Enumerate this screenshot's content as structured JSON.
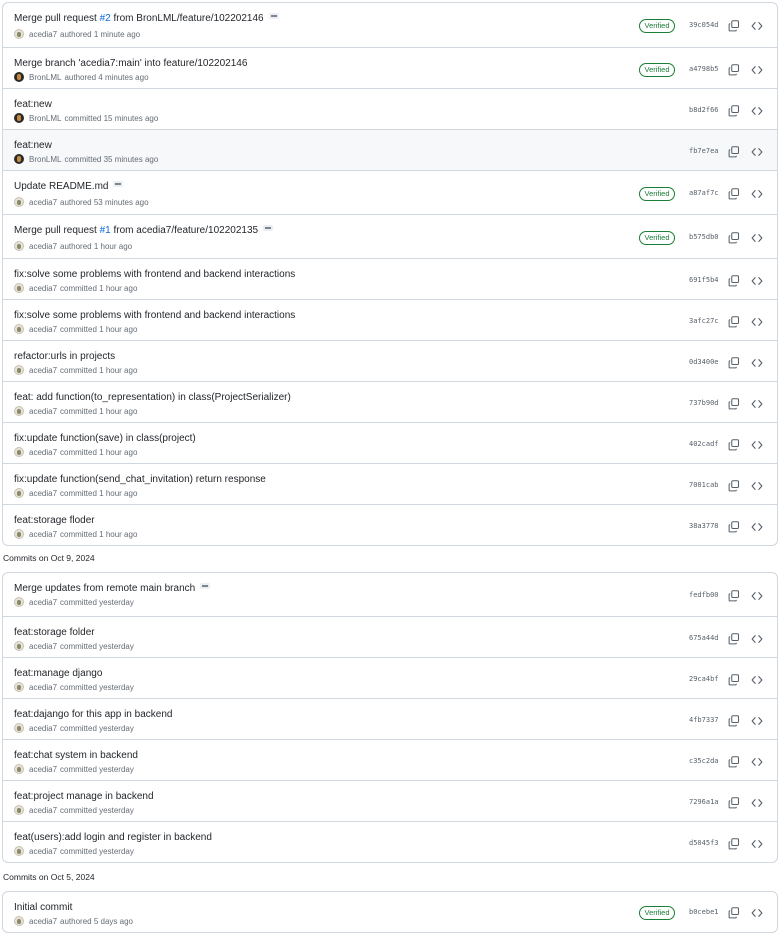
{
  "groups": [
    {
      "heading": null,
      "commits": [
        {
          "title": "Merge pull request ",
          "link": "#2",
          "title_after": " from BronLML/feature/102202146",
          "has_ellipsis": true,
          "author": "acedia7",
          "action": "authored 1 minute ago",
          "avatar": "acedia",
          "verified": true,
          "sha": "39c054d",
          "height": 44,
          "hl": false
        },
        {
          "title": "Merge branch 'acedia7:main' into feature/102202146",
          "author": "BronLML",
          "action": "authored 4 minutes ago",
          "avatar": "bron",
          "verified": true,
          "sha": "a4798b5",
          "height": 41,
          "hl": false
        },
        {
          "title": "feat:new",
          "author": "BronLML",
          "action": "committed 15 minutes ago",
          "avatar": "bron",
          "verified": false,
          "sha": "b8d2f66",
          "height": 41,
          "hl": false
        },
        {
          "title": "feat:new",
          "author": "BronLML",
          "action": "committed 35 minutes ago",
          "avatar": "bron",
          "verified": false,
          "sha": "fb7e7ea",
          "height": 41,
          "hl": true
        },
        {
          "title": "Update README.md",
          "has_ellipsis": true,
          "author": "acedia7",
          "action": "authored 53 minutes ago",
          "avatar": "acedia",
          "verified": true,
          "sha": "a87af7c",
          "height": 44,
          "hl": false
        },
        {
          "title": "Merge pull request ",
          "link": "#1",
          "title_after": " from acedia7/feature/102202135",
          "has_ellipsis": true,
          "author": "acedia7",
          "action": "authored 1 hour ago",
          "avatar": "acedia",
          "verified": true,
          "sha": "b575db0",
          "height": 44,
          "hl": false
        },
        {
          "title": "fix:solve some problems with frontend and backend interactions",
          "author": "acedia7",
          "action": "committed 1 hour ago",
          "avatar": "acedia",
          "verified": false,
          "sha": "691f5b4",
          "height": 41,
          "hl": false
        },
        {
          "title": "fix:solve some problems with frontend and backend interactions",
          "author": "acedia7",
          "action": "committed 1 hour ago",
          "avatar": "acedia",
          "verified": false,
          "sha": "3afc27c",
          "height": 41,
          "hl": false
        },
        {
          "title": "refactor:urls in projects",
          "author": "acedia7",
          "action": "committed 1 hour ago",
          "avatar": "acedia",
          "verified": false,
          "sha": "0d3400e",
          "height": 41,
          "hl": false
        },
        {
          "title": "feat: add function(to_representation) in class(ProjectSerializer)",
          "author": "acedia7",
          "action": "committed 1 hour ago",
          "avatar": "acedia",
          "verified": false,
          "sha": "737b90d",
          "height": 41,
          "hl": false
        },
        {
          "title": "fix:update function(save) in class(project)",
          "author": "acedia7",
          "action": "committed 1 hour ago",
          "avatar": "acedia",
          "verified": false,
          "sha": "402cadf",
          "height": 41,
          "hl": false
        },
        {
          "title": "fix:update function(send_chat_invitation) return response",
          "author": "acedia7",
          "action": "committed 1 hour ago",
          "avatar": "acedia",
          "verified": false,
          "sha": "7001cab",
          "height": 41,
          "hl": false
        },
        {
          "title": "feat:storage floder",
          "author": "acedia7",
          "action": "committed 1 hour ago",
          "avatar": "acedia",
          "verified": false,
          "sha": "38a3778",
          "height": 41,
          "hl": false
        }
      ]
    },
    {
      "heading": "Commits on Oct 9, 2024",
      "commits": [
        {
          "title": "Merge updates from remote main branch",
          "has_ellipsis": true,
          "author": "acedia7",
          "action": "committed yesterday",
          "avatar": "acedia",
          "verified": false,
          "sha": "fedfb00",
          "height": 43,
          "hl": false
        },
        {
          "title": "feat:storage folder",
          "author": "acedia7",
          "action": "committed yesterday",
          "avatar": "acedia",
          "verified": false,
          "sha": "675a44d",
          "height": 41,
          "hl": false
        },
        {
          "title": "feat:manage django",
          "author": "acedia7",
          "action": "committed yesterday",
          "avatar": "acedia",
          "verified": false,
          "sha": "29ca4bf",
          "height": 41,
          "hl": false
        },
        {
          "title": "feat:dajango for this app in backend",
          "author": "acedia7",
          "action": "committed yesterday",
          "avatar": "acedia",
          "verified": false,
          "sha": "4fb7337",
          "height": 41,
          "hl": false
        },
        {
          "title": "feat:chat system in backend",
          "author": "acedia7",
          "action": "committed yesterday",
          "avatar": "acedia",
          "verified": false,
          "sha": "c35c2da",
          "height": 41,
          "hl": false
        },
        {
          "title": "feat:project manage in backend",
          "author": "acedia7",
          "action": "committed yesterday",
          "avatar": "acedia",
          "verified": false,
          "sha": "7296a1a",
          "height": 41,
          "hl": false
        },
        {
          "title": "feat(users):add login and register in backend",
          "author": "acedia7",
          "action": "committed yesterday",
          "avatar": "acedia",
          "verified": false,
          "sha": "d5045f3",
          "height": 41,
          "hl": false
        }
      ]
    },
    {
      "heading": "Commits on Oct 5, 2024",
      "commits": [
        {
          "title": "Initial commit",
          "author": "acedia7",
          "action": "authored 5 days ago",
          "avatar": "acedia",
          "verified": true,
          "sha": "b0cebe1",
          "height": 40,
          "hl": false
        }
      ]
    }
  ],
  "labels": {
    "verified": "Verified"
  },
  "icons": {
    "copy": "copy-icon",
    "browse": "code-icon"
  }
}
